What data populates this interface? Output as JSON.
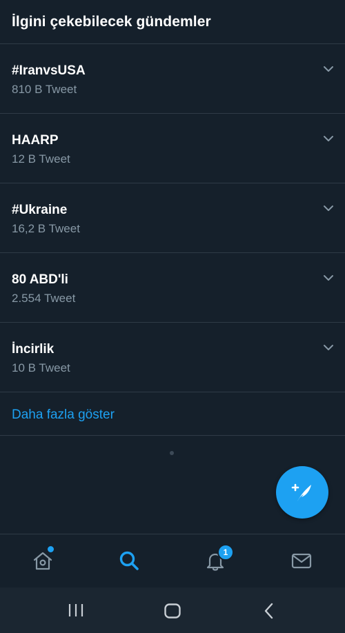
{
  "header": {
    "title": "İlgini çekebilecek gündemler"
  },
  "trends": [
    {
      "name": "#IranvsUSA",
      "count": "810 B Tweet"
    },
    {
      "name": "HAARP",
      "count": "12 B Tweet"
    },
    {
      "name": "#Ukraine",
      "count": "16,2 B Tweet"
    },
    {
      "name": "80 ABD'li",
      "count": "2.554 Tweet"
    },
    {
      "name": "İncirlik",
      "count": "10 B Tweet"
    }
  ],
  "show_more": {
    "label": "Daha fazla göster"
  },
  "fab": {
    "icon": "compose-tweet-icon"
  },
  "bottom_nav": {
    "items": [
      {
        "id": "home",
        "icon": "home-icon",
        "has_dot": true
      },
      {
        "id": "search",
        "icon": "search-icon",
        "active": true
      },
      {
        "id": "notifications",
        "icon": "bell-icon",
        "badge": "1"
      },
      {
        "id": "messages",
        "icon": "mail-icon"
      }
    ]
  },
  "system_nav": {
    "items": [
      {
        "id": "recents",
        "icon": "recent-apps-icon"
      },
      {
        "id": "home",
        "icon": "home-button-icon"
      },
      {
        "id": "back",
        "icon": "back-icon"
      }
    ]
  },
  "colors": {
    "background": "#15202b",
    "accent": "#1da1f2",
    "secondary_text": "#8899a6",
    "divider": "#2f3b47"
  }
}
